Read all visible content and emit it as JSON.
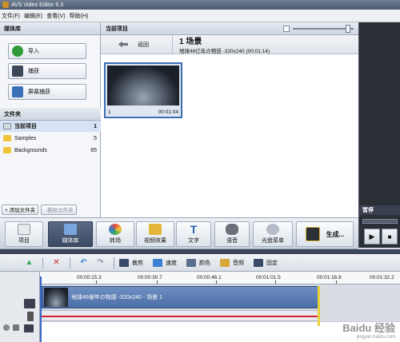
{
  "window": {
    "title": "AVS Video Editor 6.3"
  },
  "menu": [
    "文件(F)",
    "编辑(E)",
    "查看(V)",
    "帮助(H)"
  ],
  "media_library": {
    "header": "媒体库",
    "buttons": {
      "import": "导入",
      "capture": "捕获",
      "screen_capture": "屏幕捕获"
    }
  },
  "folders": {
    "header": "文件夹",
    "items": [
      {
        "label": "当前项目",
        "count": "1"
      },
      {
        "label": "Samples",
        "count": "5"
      },
      {
        "label": "Backgrounds",
        "count": "65"
      }
    ],
    "add_label": "+ 添加文件夹",
    "delete_label": "- 删除文件夹"
  },
  "project": {
    "header": "当前项目",
    "back_label": "返回",
    "scene_title": "1 场景",
    "scene_meta": "地球46亿年の物語 -320x240  (00:01:14)",
    "clip": {
      "index": "1",
      "duration": "00:01:04"
    }
  },
  "preview": {
    "state_label": "暂停",
    "play": "▶",
    "stop": "■"
  },
  "toolbar": {
    "project": "项目",
    "media_library": "媒体库",
    "transitions": "转场",
    "video_effects": "视频效果",
    "text": "文字",
    "voice": "语音",
    "disc_menu": "光盘菜单",
    "produce": "生成..."
  },
  "timeline_tools": {
    "trim": "裁剪",
    "speed": "速度",
    "color": "颜色",
    "audio": "音频",
    "freeze": "固定"
  },
  "ruler": [
    "00:00:15.3",
    "00:00:30.7",
    "00:00:46.1",
    "00:01:01.5",
    "00:01:16.8",
    "00:01:32.2"
  ],
  "timeline_clip": {
    "label": "地球46億年の物語 -320x240 - 场景 1"
  },
  "watermark": {
    "main": "Baidu 经验",
    "sub": "jingyan.baidu.com"
  },
  "colors": {
    "accent": "#3d6db2",
    "active_button": "#4b5b78",
    "clip": "#5a7db5",
    "audio_line": "#d2242a"
  }
}
